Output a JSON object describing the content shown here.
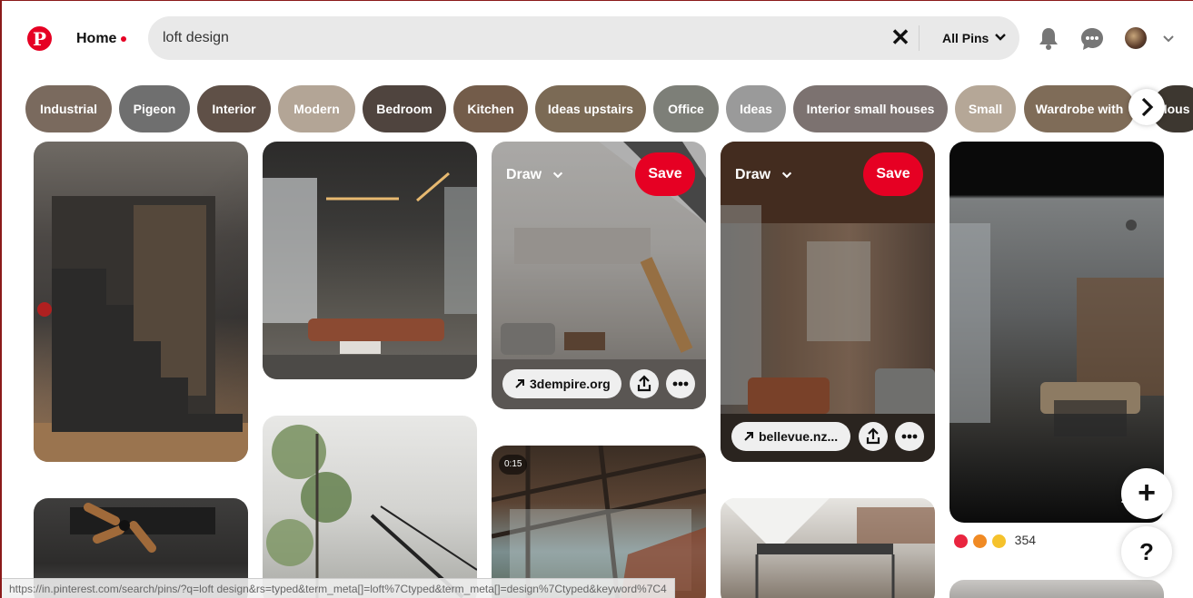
{
  "header": {
    "logo_letter": "P",
    "home_label": "Home",
    "search_value": "loft design",
    "search_clear": "✕",
    "filter_label": "All Pins"
  },
  "categories": [
    {
      "label": "Industrial",
      "color": "#7a6a5e"
    },
    {
      "label": "Pigeon",
      "color": "#6f6f6f"
    },
    {
      "label": "Interior",
      "color": "#5f5047"
    },
    {
      "label": "Modern",
      "color": "#b3a596"
    },
    {
      "label": "Bedroom",
      "color": "#4f443e"
    },
    {
      "label": "Kitchen",
      "color": "#735c4a"
    },
    {
      "label": "Ideas upstairs",
      "color": "#7b6a55"
    },
    {
      "label": "Office",
      "color": "#7d7f78"
    },
    {
      "label": "Ideas",
      "color": "#9a9a9a"
    },
    {
      "label": "Interior small houses",
      "color": "#7c7270"
    },
    {
      "label": "Small",
      "color": "#b5a797"
    },
    {
      "label": "Wardrobe with",
      "color": "#7f6c58"
    },
    {
      "label": "Hous",
      "color": "#3d3730"
    }
  ],
  "pins": {
    "pin3": {
      "board": "Draw",
      "save": "Save",
      "link": "3dempire.org"
    },
    "pin4": {
      "board": "Draw",
      "save": "Save",
      "link": "bellevue.nz..."
    },
    "video_time": "0:15",
    "reaction_count": "354"
  },
  "fab": {
    "add": "+",
    "help": "?"
  },
  "status_url": "https://in.pinterest.com/search/pins/?q=loft design&rs=typed&term_meta[]=loft%7Ctyped&term_meta[]=design%7Ctyped&keyword%7C4"
}
